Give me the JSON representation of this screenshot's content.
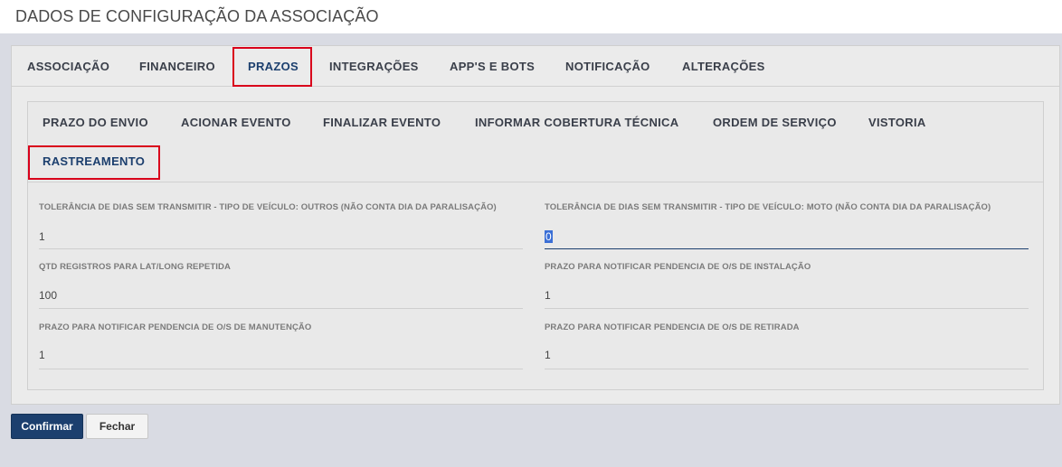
{
  "page": {
    "title": "DADOS DE CONFIGURAÇÃO DA ASSOCIAÇÃO"
  },
  "main_tabs": [
    {
      "label": "ASSOCIAÇÃO"
    },
    {
      "label": "FINANCEIRO"
    },
    {
      "label": "PRAZOS",
      "active": true
    },
    {
      "label": "INTEGRAÇÕES"
    },
    {
      "label": "APP'S E BOTS"
    },
    {
      "label": "NOTIFICAÇÃO"
    },
    {
      "label": "ALTERAÇÕES"
    }
  ],
  "sub_tabs": [
    {
      "label": "PRAZO DO ENVIO"
    },
    {
      "label": "ACIONAR EVENTO"
    },
    {
      "label": "FINALIZAR EVENTO"
    },
    {
      "label": "INFORMAR COBERTURA TÉCNICA"
    },
    {
      "label": "ORDEM DE SERVIÇO"
    },
    {
      "label": "VISTORIA"
    },
    {
      "label": "RASTREAMENTO",
      "active": true
    }
  ],
  "fields": [
    {
      "label": "TOLERÂNCIA DE DIAS SEM TRANSMITIR - TIPO DE VEÍCULO: OUTROS (NÃO CONTA DIA DA PARALISAÇÃO)",
      "value": "1"
    },
    {
      "label": "TOLERÂNCIA DE DIAS SEM TRANSMITIR - TIPO DE VEÍCULO: MOTO (NÃO CONTA DIA DA PARALISAÇÃO)",
      "value": "0",
      "focused": true
    },
    {
      "label": "QTD REGISTROS PARA LAT/LONG REPETIDA",
      "value": "100"
    },
    {
      "label": "PRAZO PARA NOTIFICAR PENDENCIA DE O/S DE INSTALAÇÃO",
      "value": "1"
    },
    {
      "label": "PRAZO PARA NOTIFICAR PENDENCIA DE O/S DE MANUTENÇÃO",
      "value": "1"
    },
    {
      "label": "PRAZO PARA NOTIFICAR PENDENCIA DE O/S DE RETIRADA",
      "value": "1"
    }
  ],
  "buttons": {
    "confirm": "Confirmar",
    "close": "Fechar"
  },
  "colors": {
    "accent": "#1c3f6e",
    "highlight_box": "#d9001b"
  }
}
